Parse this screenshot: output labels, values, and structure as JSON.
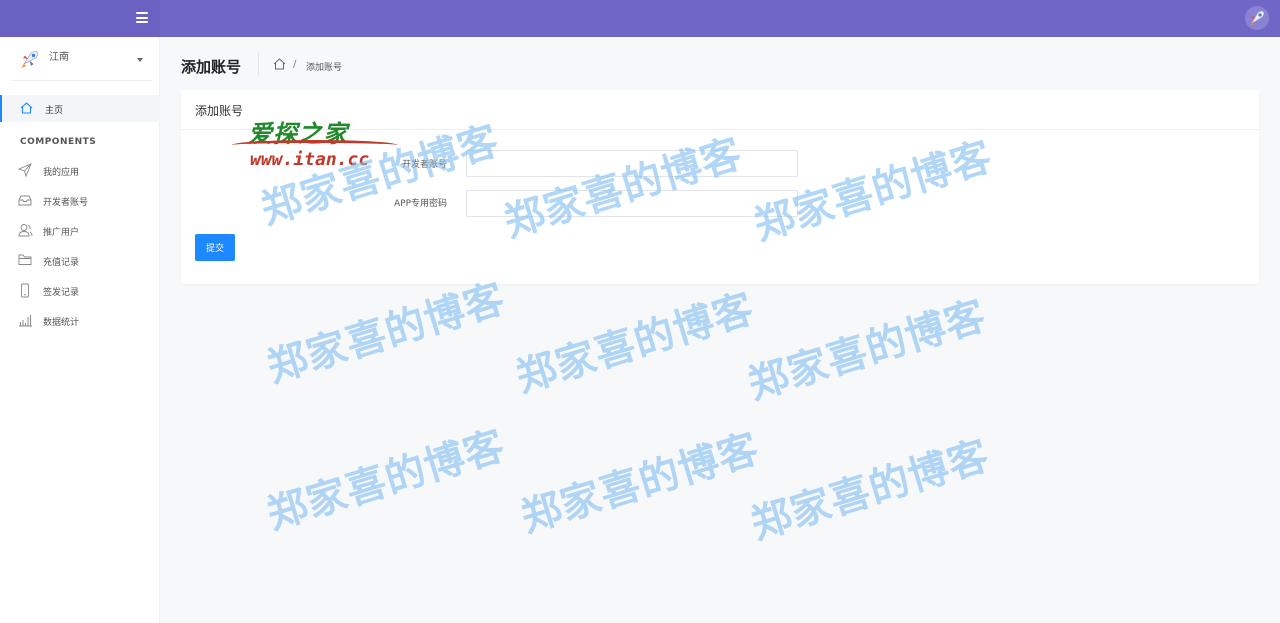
{
  "app": {
    "user_name": "江南"
  },
  "sidebar": {
    "home_label": "主页",
    "section_label": "COMPONENTS",
    "items": [
      {
        "label": "我的应用",
        "icon": "send-icon"
      },
      {
        "label": "开发者账号",
        "icon": "inbox-icon"
      },
      {
        "label": "推广用户",
        "icon": "users-icon"
      },
      {
        "label": "充值记录",
        "icon": "folder-icon"
      },
      {
        "label": "签发记录",
        "icon": "phone-icon"
      },
      {
        "label": "数据统计",
        "icon": "bar-chart-icon"
      }
    ]
  },
  "header": {
    "title": "添加账号",
    "breadcrumb_separator": "/",
    "breadcrumb_current": "添加账号"
  },
  "card": {
    "title": "添加账号",
    "fields": [
      {
        "label": "开发者账号",
        "value": ""
      },
      {
        "label": "APP专用密码",
        "value": ""
      }
    ],
    "submit_label": "提交"
  },
  "watermark": {
    "text": "郑家喜的博客",
    "stamp_title": "爱探之家",
    "stamp_url": "www.itan.cc"
  },
  "colors": {
    "topbar": "#6f66c7",
    "accent": "#1e88ff",
    "watermark": "#82bef0"
  }
}
